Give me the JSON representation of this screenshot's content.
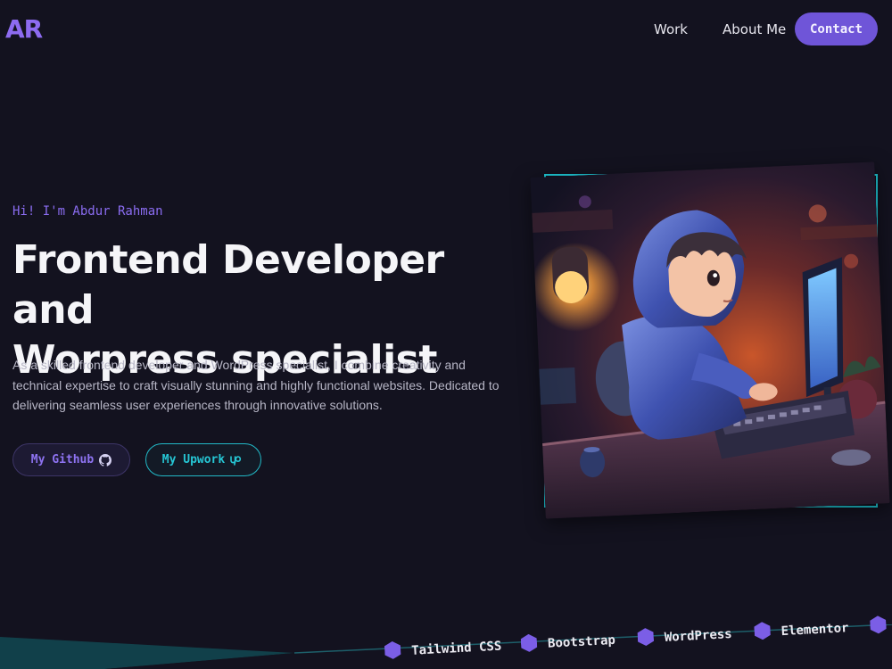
{
  "nav": {
    "logo": "AR",
    "links": [
      {
        "label": "Work"
      },
      {
        "label": "About Me"
      }
    ],
    "contact_label": "Contact"
  },
  "hero": {
    "greeting": "Hi! I'm Abdur Rahman",
    "headline_line1": "Frontend Developer and",
    "headline_line2": "Worpress specialist",
    "description": "As a skilled frontend developer and WordPress specialist, I combine creativity and technical expertise to craft visually stunning and highly functional websites. Dedicated to delivering seamless user experiences through innovative solutions.",
    "github_label": "My Github",
    "upwork_label": "My Upwork"
  },
  "skills": [
    {
      "label": "Tailwind CSS",
      "icon": "hexagon-icon"
    },
    {
      "label": "Bootstrap",
      "icon": "hexagon-icon"
    },
    {
      "label": "WordPress",
      "icon": "hexagon-icon"
    },
    {
      "label": "Elementor",
      "icon": "hexagon-icon"
    }
  ],
  "colors": {
    "background": "#13121f",
    "accent_purple": "#6f55d8",
    "accent_teal": "#1ec9d6"
  }
}
